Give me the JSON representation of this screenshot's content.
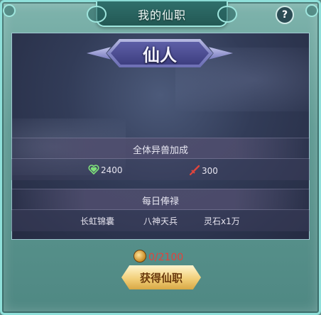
{
  "window": {
    "title": "我的仙职",
    "help_label": "?"
  },
  "rank": {
    "name": "仙人"
  },
  "bonus": {
    "heading": "全体异兽加成",
    "stats": [
      {
        "icon": "heart-icon",
        "value": "2400",
        "color": "#7ee07a"
      },
      {
        "icon": "sword-icon",
        "value": "300",
        "color": "#e0453d"
      }
    ]
  },
  "salary": {
    "heading": "每日俸禄",
    "items": [
      "长虹锦囊",
      "八神天兵",
      "灵石x1万"
    ]
  },
  "cost": {
    "icon": "coin-icon",
    "value": "0/2100",
    "color": "#e5413b"
  },
  "action": {
    "button_label": "获得仙职"
  }
}
